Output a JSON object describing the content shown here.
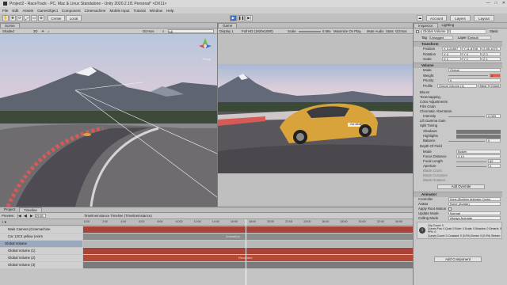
{
  "window": {
    "title": "Project2 - RaceTrack - PC, Mac & Linux Standalone - Unity 2020.2.1f1 Personal* <DX11>",
    "minimize": "—",
    "maximize": "□",
    "close": "✕"
  },
  "menu": [
    "File",
    "Edit",
    "Assets",
    "GameObject",
    "Component",
    "Cinemachine",
    "Mobile Input",
    "Tutorial",
    "Window",
    "Help"
  ],
  "toolbar": {
    "center": "Center",
    "local": "Local",
    "account": "Account",
    "layers": "Layers",
    "layout": "Layout"
  },
  "scene": {
    "tabs": [
      "Scene"
    ],
    "shading": "Shaded",
    "mode_2d": "2D",
    "gizmos": "Gizmos",
    "search_placeholder": "All",
    "persp": "Persp"
  },
  "game": {
    "tabs": [
      "Game"
    ],
    "display": "Display 1",
    "resolution": "Full HD (1920x1080)",
    "scale_label": "Scale",
    "scale_value": "0.58x",
    "maximize": "Maximize On Play",
    "mute": "Mute Audio",
    "stats": "Stats",
    "gizmos": "Gizmos",
    "plate": "GA·2834"
  },
  "inspector": {
    "tabs": [
      "Inspector",
      "Lighting"
    ],
    "object_name": "Global Volume (2)",
    "static": "Static",
    "tag_label": "Tag",
    "tag_value": "Untagged",
    "layer_label": "Layer",
    "layer_value": "Default",
    "transform": {
      "title": "Transform",
      "position_label": "Position",
      "position": [
        "X 3.24597",
        "Y 11.8798",
        "Z 85.1073"
      ],
      "rotation_label": "Rotation",
      "rotation": [
        "X 0",
        "Y 0",
        "Z 0"
      ],
      "scale_label": "Scale",
      "scale": [
        "X 1",
        "Y 1",
        "Z 1"
      ]
    },
    "volume": {
      "title": "Volume",
      "mode_label": "Mode",
      "mode_value": "Global",
      "weight_label": "Weight",
      "weight_value": "1",
      "priority_label": "Priority",
      "priority_value": "0",
      "profile_label": "Profile",
      "profile_value": "Global Volume (1)",
      "new": "New",
      "clone": "Clone"
    },
    "overrides": [
      "Bloom",
      "Tonemapping",
      "Color Adjustments",
      "Film Grain",
      "Chromatic Aberration"
    ],
    "intensity_label": "Intensity",
    "intensity_value": "0.083",
    "lift_gamma_gain": "Lift Gamma Gain",
    "split_toning": {
      "title": "Split Toning",
      "shadows": "Shadows",
      "highlights": "Highlights",
      "balance": "Balance",
      "balance_value": "0"
    },
    "depth_of_field": {
      "title": "Depth Of Field",
      "mode_label": "Mode",
      "mode_value": "Bokeh",
      "focus_label": "Focus Distance",
      "focus_value": "3.13",
      "focal_label": "Focal Length",
      "focal_value": "82",
      "aperture_label": "Aperture",
      "aperture_value": "4",
      "blade_count": "Blade Count",
      "blade_curvature": "Blade Curvature",
      "blade_rotation": "Blade Rotation"
    },
    "add_override": "Add Override",
    "animator": {
      "title": "Animator",
      "controller_label": "Controller",
      "controller_value": "None (Runtime Animator Contro",
      "avatar_label": "Avatar",
      "avatar_value": "None (Avatar)",
      "root_motion": "Apply Root Motion",
      "update_label": "Update Mode",
      "update_value": "Normal",
      "culling_label": "Culling Mode",
      "culling_value": "Always Animate",
      "info": "Clip Count: 0\nCurves Pos: 0 Quat: 0 Euler: 0 Scale: 0 Muscles: 0 Generic: 0 PPtr: 0\nCurves Count: 0 Constant: 0 (0.0%) Dense: 0 (0.0%) Stream: 0 (0.0%)"
    },
    "add_component": "Add Component"
  },
  "timeline": {
    "tabs": [
      "Project",
      "Timeline"
    ],
    "preview": "Preview",
    "frame": "29:58",
    "breadcrumb": "TimelineInstance Timeline (Timelineinstance)",
    "ticks": [
      "0:00",
      "2:00",
      "4:00",
      "6:00",
      "8:00",
      "10:00",
      "12:00",
      "14:00",
      "16:00",
      "18:00",
      "20:00",
      "22:00",
      "24:00",
      "26:00",
      "28:00",
      "30:00",
      "32:00",
      "34:00"
    ],
    "tracks": [
      "Main Camera (Cinemachine",
      "Car 12C3 yellow (Anim",
      "Global Volume",
      "Global Volume (1)",
      "Global Volume (2)",
      "Global Volume (3)"
    ],
    "clip_labels": [
      "Animation",
      "Recorded"
    ]
  },
  "colors": {
    "accent_blue": "#3a72c9",
    "track_red": "#b24a36",
    "track_gray": "#7a7a7a",
    "car_yellow": "#d8a33a"
  }
}
